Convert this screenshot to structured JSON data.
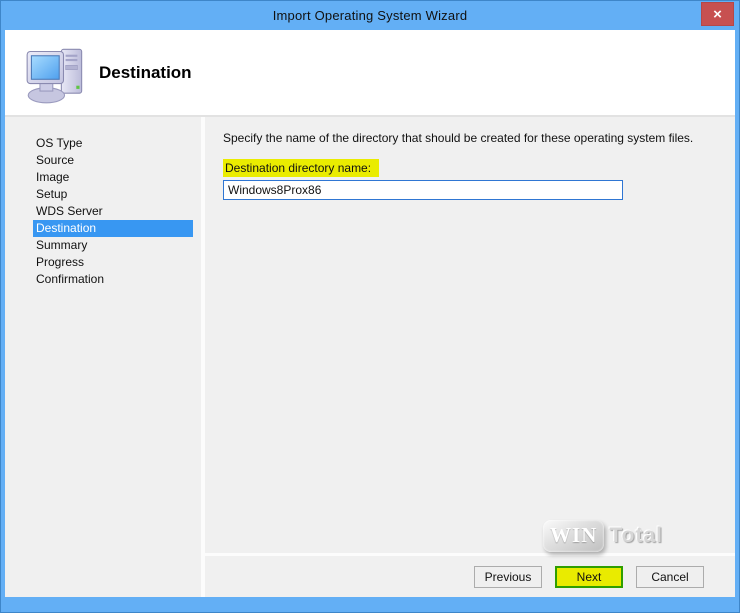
{
  "window": {
    "title": "Import Operating System Wizard",
    "close_glyph": "×"
  },
  "header": {
    "title": "Destination",
    "icon": "computer-workstation-icon"
  },
  "sidebar": {
    "items": [
      {
        "label": "OS Type",
        "selected": false
      },
      {
        "label": "Source",
        "selected": false
      },
      {
        "label": "Image",
        "selected": false
      },
      {
        "label": "Setup",
        "selected": false
      },
      {
        "label": "WDS Server",
        "selected": false
      },
      {
        "label": "Destination",
        "selected": true
      },
      {
        "label": "Summary",
        "selected": false
      },
      {
        "label": "Progress",
        "selected": false
      },
      {
        "label": "Confirmation",
        "selected": false
      }
    ]
  },
  "main": {
    "instruction": "Specify the name of the directory that should be created for these operating system files.",
    "field": {
      "label": "Destination directory name:",
      "value": "Windows8Prox86"
    }
  },
  "watermark": {
    "win": "WIN",
    "total": "Total"
  },
  "footer": {
    "buttons": [
      {
        "label": "Previous",
        "highlighted": false
      },
      {
        "label": "Next",
        "highlighted": true
      },
      {
        "label": "Cancel",
        "highlighted": false
      }
    ]
  },
  "colors": {
    "chrome_blue": "#63AFF5",
    "chrome_outline": "#3E86C9",
    "close_red": "#C75050",
    "selection_blue": "#3897F2",
    "highlight_yellow": "#EAEC00",
    "next_border_green": "#2F9E00",
    "content_gray": "#F0F0F0",
    "input_border_blue": "#2F76D3"
  }
}
